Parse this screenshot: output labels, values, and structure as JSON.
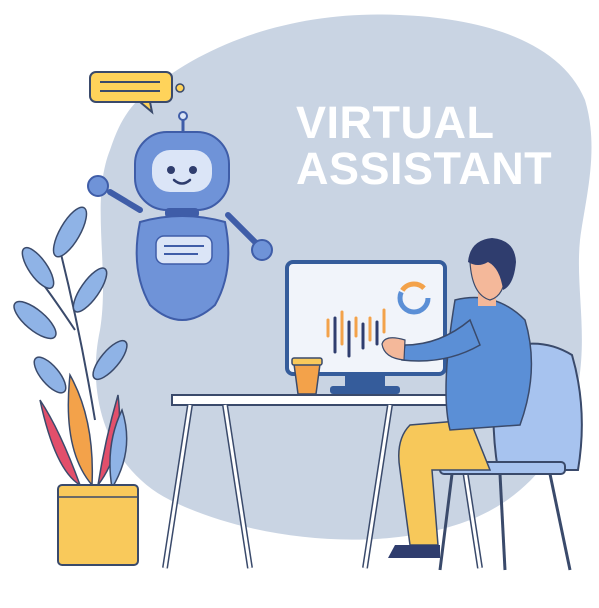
{
  "headline": {
    "line1": "VIRTUAL",
    "line2": "ASSISTANT"
  },
  "colors": {
    "blob": "#c9d4e3",
    "robot_body": "#6f93d8",
    "robot_dark": "#3f5da8",
    "robot_light": "#dbe5f7",
    "speech_bubble": "#ffd35a",
    "monitor_frame": "#355c9b",
    "desk": "#ffffff",
    "desk_outline": "#3a4a6b",
    "pants": "#f7c85a",
    "shirt": "#5b8fd6",
    "chair": "#a7c3ef",
    "hair": "#2f3d6e",
    "pot": "#f9c95b",
    "leaf_blue": "#8fb3e6",
    "leaf_orange": "#f3a24a",
    "leaf_red": "#e24f6b"
  },
  "icons": [
    "robot-icon",
    "speech-bubble-icon",
    "monitor-icon",
    "coffee-cup-icon",
    "plant-icon",
    "person-icon",
    "chair-icon",
    "desk-icon"
  ]
}
